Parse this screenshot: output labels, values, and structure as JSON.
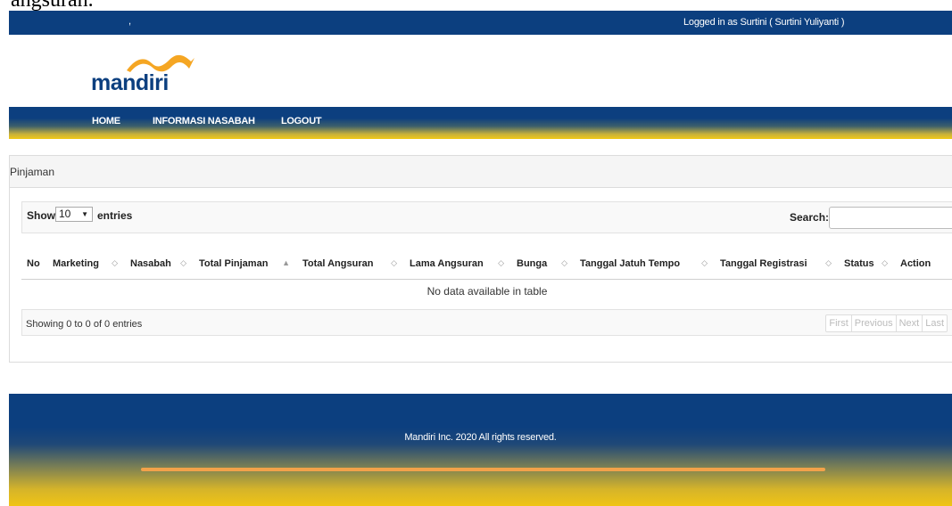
{
  "caption": "angsuran.",
  "topbar": {
    "comma": ",",
    "login_info": "Logged in as Surtini ( Surtini Yuliyanti )"
  },
  "logo": {
    "wordmark": "mandiri",
    "wave_color": "#f5a623",
    "text_color": "#0c3f7f"
  },
  "nav": {
    "items": [
      {
        "label": "HOME"
      },
      {
        "label": "INFORMASI NASABAH"
      },
      {
        "label": "LOGOUT"
      }
    ]
  },
  "panel": {
    "title": "Pinjaman"
  },
  "table_controls": {
    "show_label": "Show",
    "entries_value": "10",
    "entries_label": "entries",
    "search_label": "Search:",
    "search_value": ""
  },
  "table": {
    "columns": [
      {
        "label": "No",
        "sort": ""
      },
      {
        "label": "Marketing",
        "sort": "◇"
      },
      {
        "label": "Nasabah",
        "sort": "◇"
      },
      {
        "label": "Total Pinjaman",
        "sort": "▲"
      },
      {
        "label": "Total Angsuran",
        "sort": "◇"
      },
      {
        "label": "Lama Angsuran",
        "sort": "◇"
      },
      {
        "label": "Bunga",
        "sort": "◇"
      },
      {
        "label": "Tanggal Jatuh Tempo",
        "sort": "◇"
      },
      {
        "label": "Tanggal Registrasi",
        "sort": "◇"
      },
      {
        "label": "Status",
        "sort": "◇"
      },
      {
        "label": "Action",
        "sort": ""
      }
    ],
    "empty_message": "No data available in table",
    "info": "Showing 0 to 0 of 0 entries"
  },
  "pagination": {
    "first": "First",
    "previous": "Previous",
    "next": "Next",
    "last": "Last"
  },
  "footer": {
    "copyright": "Mandiri Inc. 2020 All rights reserved."
  },
  "colors": {
    "brand_blue": "#0c3f7f",
    "brand_yellow": "#f1c817",
    "accent_orange": "#f3a24a"
  }
}
